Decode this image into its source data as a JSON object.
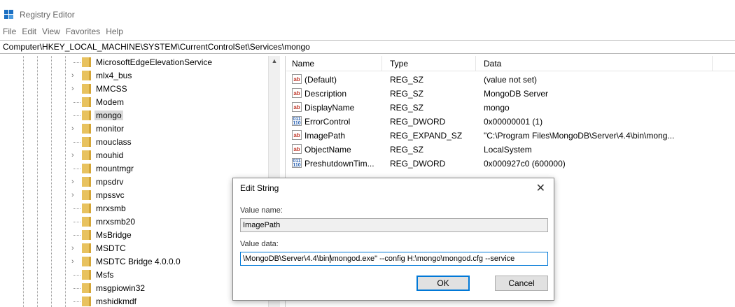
{
  "window": {
    "title": "Registry Editor"
  },
  "menu": [
    "File",
    "Edit",
    "View",
    "Favorites",
    "Help"
  ],
  "address": "Computer\\HKEY_LOCAL_MACHINE\\SYSTEM\\CurrentControlSet\\Services\\mongo",
  "tree": {
    "items": [
      {
        "label": "MicrosoftEdgeElevationService",
        "expandable": false
      },
      {
        "label": "mlx4_bus",
        "expandable": true
      },
      {
        "label": "MMCSS",
        "expandable": true
      },
      {
        "label": "Modem",
        "expandable": false
      },
      {
        "label": "mongo",
        "expandable": false,
        "selected": true
      },
      {
        "label": "monitor",
        "expandable": true
      },
      {
        "label": "mouclass",
        "expandable": false
      },
      {
        "label": "mouhid",
        "expandable": true
      },
      {
        "label": "mountmgr",
        "expandable": false
      },
      {
        "label": "mpsdrv",
        "expandable": true
      },
      {
        "label": "mpssvc",
        "expandable": true
      },
      {
        "label": "mrxsmb",
        "expandable": false
      },
      {
        "label": "mrxsmb20",
        "expandable": false
      },
      {
        "label": "MsBridge",
        "expandable": false
      },
      {
        "label": "MSDTC",
        "expandable": true
      },
      {
        "label": "MSDTC Bridge 4.0.0.0",
        "expandable": true
      },
      {
        "label": "Msfs",
        "expandable": false
      },
      {
        "label": "msgpiowin32",
        "expandable": false
      },
      {
        "label": "mshidkmdf",
        "expandable": false
      }
    ]
  },
  "list": {
    "headers": {
      "name": "Name",
      "type": "Type",
      "data": "Data"
    },
    "rows": [
      {
        "icon": "string-value-icon",
        "name": "(Default)",
        "type": "REG_SZ",
        "data": "(value not set)"
      },
      {
        "icon": "string-value-icon",
        "name": "Description",
        "type": "REG_SZ",
        "data": "MongoDB Server"
      },
      {
        "icon": "string-value-icon",
        "name": "DisplayName",
        "type": "REG_SZ",
        "data": "mongo"
      },
      {
        "icon": "dword-value-icon",
        "name": "ErrorControl",
        "type": "REG_DWORD",
        "data": "0x00000001 (1)"
      },
      {
        "icon": "string-value-icon",
        "name": "ImagePath",
        "type": "REG_EXPAND_SZ",
        "data": "\"C:\\Program Files\\MongoDB\\Server\\4.4\\bin\\mong..."
      },
      {
        "icon": "string-value-icon",
        "name": "ObjectName",
        "type": "REG_SZ",
        "data": "LocalSystem"
      },
      {
        "icon": "dword-value-icon",
        "name": "PreshutdownTim...",
        "type": "REG_DWORD",
        "data": "0x000927c0 (600000)"
      }
    ]
  },
  "dialog": {
    "title": "Edit String",
    "value_name_label": "Value name:",
    "value_name": "ImagePath",
    "value_data_label": "Value data:",
    "value_data_before_caret": "\\MongoDB\\Server\\4.4\\bin",
    "value_data_after_caret": "\\mongod.exe\" --config H:\\mongo\\mongod.cfg --service",
    "ok_label": "OK",
    "cancel_label": "Cancel",
    "close_glyph": "✕"
  },
  "icons": {
    "string": "ab",
    "dword": "011 110"
  }
}
